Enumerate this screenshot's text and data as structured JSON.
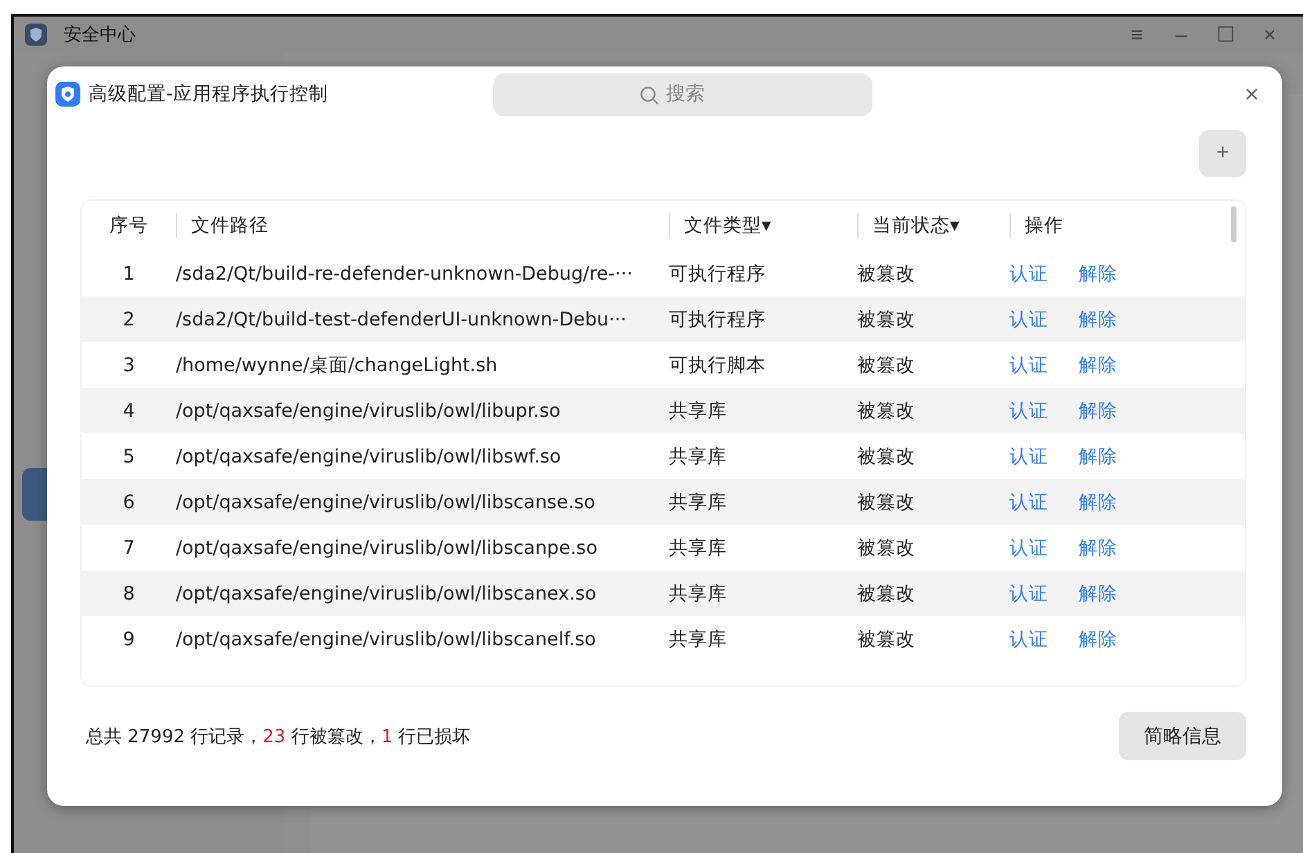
{
  "window": {
    "title": "安全中心",
    "controls": [
      "≡",
      "–",
      "☐",
      "×"
    ]
  },
  "dialog": {
    "title": "高级配置-应用程序执行控制",
    "close": "×",
    "add_button": "+"
  },
  "search": {
    "placeholder": "搜索"
  },
  "table": {
    "columns": [
      "序号",
      "文件路径",
      "文件类型▾",
      "当前状态▾",
      "操作"
    ],
    "rows": [
      {
        "index": "1",
        "path": "/sda2/Qt/build-re-defender-unknown-Debug/re-···",
        "type": "可执行程序",
        "status": "被篡改",
        "actions": [
          "认证",
          "解除"
        ]
      },
      {
        "index": "2",
        "path": "/sda2/Qt/build-test-defenderUI-unknown-Debu···",
        "type": "可执行程序",
        "status": "被篡改",
        "actions": [
          "认证",
          "解除"
        ]
      },
      {
        "index": "3",
        "path": "/home/wynne/桌面/changeLight.sh",
        "type": "可执行脚本",
        "status": "被篡改",
        "actions": [
          "认证",
          "解除"
        ]
      },
      {
        "index": "4",
        "path": "/opt/qaxsafe/engine/viruslib/owl/libupr.so",
        "type": "共享库",
        "status": "被篡改",
        "actions": [
          "认证",
          "解除"
        ]
      },
      {
        "index": "5",
        "path": "/opt/qaxsafe/engine/viruslib/owl/libswf.so",
        "type": "共享库",
        "status": "被篡改",
        "actions": [
          "认证",
          "解除"
        ]
      },
      {
        "index": "6",
        "path": "/opt/qaxsafe/engine/viruslib/owl/libscanse.so",
        "type": "共享库",
        "status": "被篡改",
        "actions": [
          "认证",
          "解除"
        ]
      },
      {
        "index": "7",
        "path": "/opt/qaxsafe/engine/viruslib/owl/libscanpe.so",
        "type": "共享库",
        "status": "被篡改",
        "actions": [
          "认证",
          "解除"
        ]
      },
      {
        "index": "8",
        "path": "/opt/qaxsafe/engine/viruslib/owl/libscanex.so",
        "type": "共享库",
        "status": "被篡改",
        "actions": [
          "认证",
          "解除"
        ]
      },
      {
        "index": "9",
        "path": "/opt/qaxsafe/engine/viruslib/owl/libscanelf.so",
        "type": "共享库",
        "status": "被篡改",
        "actions": [
          "认证",
          "解除"
        ]
      }
    ]
  },
  "summary": [
    {
      "text": "总共 27992 行记录，",
      "kind": "plain"
    },
    {
      "text": "23",
      "kind": "alert"
    },
    {
      "text": " 行被篡改，",
      "kind": "plain"
    },
    {
      "text": "1",
      "kind": "alert"
    },
    {
      "text": " 行已损坏",
      "kind": "plain"
    }
  ],
  "detail_button": "简略信息"
}
